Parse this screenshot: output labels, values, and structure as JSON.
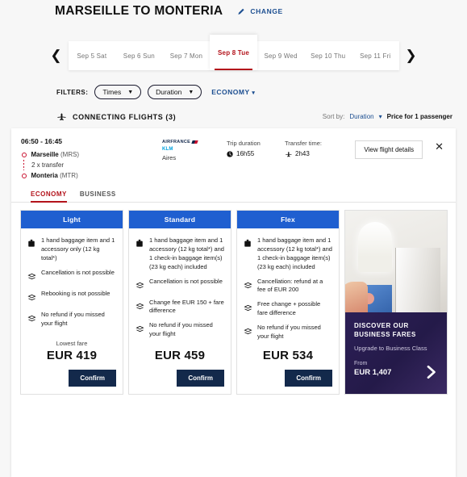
{
  "header": {
    "title": "MARSEILLE TO MONTERIA",
    "change_label": "CHANGE",
    "pencil_icon": "pencil-icon"
  },
  "date_selector": {
    "prev_icon": "chevron-left-icon",
    "next_icon": "chevron-right-icon",
    "dates": [
      {
        "label": "Sep 5 Sat",
        "active": false
      },
      {
        "label": "Sep 6 Sun",
        "active": false
      },
      {
        "label": "Sep 7 Mon",
        "active": false
      },
      {
        "label": "Sep 8 Tue",
        "active": true
      },
      {
        "label": "Sep 9 Wed",
        "active": false
      },
      {
        "label": "Sep 10 Thu",
        "active": false
      },
      {
        "label": "Sep 11 Fri",
        "active": false
      }
    ]
  },
  "filters": {
    "label": "FILTERS:",
    "times": "Times",
    "duration": "Duration",
    "cabin": "ECONOMY"
  },
  "connecting": {
    "title": "CONNECTING FLIGHTS (3)",
    "plane_icon": "plane-icon",
    "sort_label": "Sort by:",
    "sort_value": "Duration",
    "price_note": "Price for 1 passenger"
  },
  "flight": {
    "times": "06:50 - 16:45",
    "origin_city": "Marseille",
    "origin_code": "(MRS)",
    "transfer": "2 x transfer",
    "destination_city": "Monteria",
    "destination_code": "(MTR)",
    "airlines": [
      "AIRFRANCE",
      "KLM",
      "Aires"
    ],
    "trip_duration_label": "Trip duration",
    "trip_duration_value": "16h55",
    "transfer_time_label": "Transfer time:",
    "transfer_time_value": "2h43",
    "details_button": "View flight details",
    "close_icon": "close-icon"
  },
  "cabin_tabs": [
    {
      "label": "ECONOMY",
      "active": true
    },
    {
      "label": "BUSINESS",
      "active": false
    }
  ],
  "fares": [
    {
      "name": "Light",
      "benefits": [
        {
          "icon": "baggage-icon",
          "text": "1 hand baggage item and 1 accessory only (12 kg total*)"
        },
        {
          "icon": "ticket-icon",
          "text": "Cancellation is not possible"
        },
        {
          "icon": "ticket-icon",
          "text": "Rebooking is not possible"
        },
        {
          "icon": "ticket-icon",
          "text": "No refund if you missed your flight"
        }
      ],
      "lowest_fare_label": "Lowest fare",
      "price": "EUR 419",
      "confirm": "Confirm"
    },
    {
      "name": "Standard",
      "benefits": [
        {
          "icon": "baggage-icon",
          "text": "1 hand baggage item and 1 accessory (12 kg total*) and 1 check-in baggage item(s) (23 kg each) included"
        },
        {
          "icon": "ticket-icon",
          "text": "Cancellation is not possible"
        },
        {
          "icon": "ticket-icon",
          "text": "Change fee EUR 150 + fare difference"
        },
        {
          "icon": "ticket-icon",
          "text": "No refund if you missed your flight"
        }
      ],
      "lowest_fare_label": "",
      "price": "EUR 459",
      "confirm": "Confirm"
    },
    {
      "name": "Flex",
      "benefits": [
        {
          "icon": "baggage-icon",
          "text": "1 hand baggage item and 1 accessory (12 kg total*) and 1 check-in baggage item(s) (23 kg each) included"
        },
        {
          "icon": "ticket-icon",
          "text": "Cancellation: refund at a fee of EUR 200"
        },
        {
          "icon": "ticket-icon",
          "text": "Free change + possible fare difference"
        },
        {
          "icon": "ticket-icon",
          "text": "No refund if you missed your flight"
        }
      ],
      "lowest_fare_label": "",
      "price": "EUR 534",
      "confirm": "Confirm"
    }
  ],
  "promo": {
    "title": "DISCOVER OUR BUSINESS FARES",
    "subtitle": "Upgrade to Business Class",
    "from_label": "From",
    "price": "EUR 1,407",
    "arrow_icon": "chevron-right-icon"
  },
  "colors": {
    "accent_red": "#b3131b",
    "link_blue": "#1d4f91",
    "fare_header_blue": "#1f5fd0",
    "confirm_navy": "#13294b"
  }
}
